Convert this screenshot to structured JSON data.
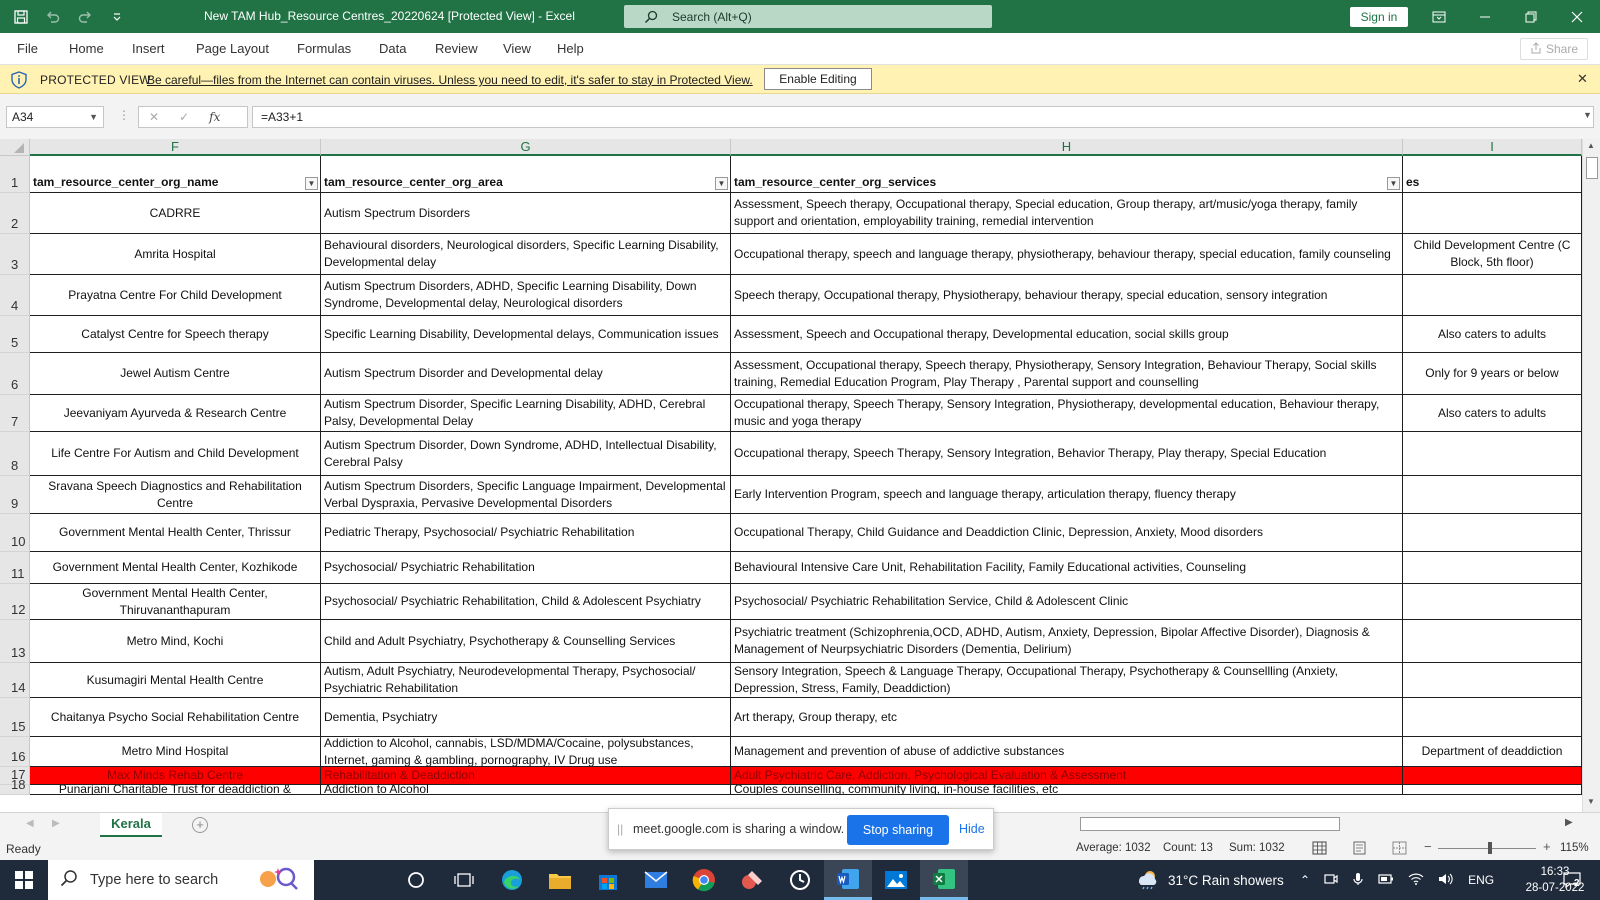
{
  "app": {
    "doc_title": "New TAM Hub_Resource Centres_20220624  [Protected View]  -  Excel",
    "search_placeholder": "Search (Alt+Q)",
    "sign_in": "Sign in",
    "accent": "#217346"
  },
  "menu": {
    "items": [
      "File",
      "Home",
      "Insert",
      "Page Layout",
      "Formulas",
      "Data",
      "Review",
      "View",
      "Help"
    ],
    "share": "Share"
  },
  "protected": {
    "title": "PROTECTED VIEW",
    "message": "Be careful—files from the Internet can contain viruses. Unless you need to edit, it's safer to stay in Protected View.",
    "enable_button": "Enable Editing"
  },
  "formula_bar": {
    "name_box": "A34",
    "formula": "=A33+1"
  },
  "grid": {
    "columns": [
      "F",
      "G",
      "H",
      "I"
    ],
    "header_row": {
      "row": "1",
      "cells": [
        "tam_resource_center_org_name",
        "tam_resource_center_org_area",
        "tam_resource_center_org_services",
        "es"
      ]
    },
    "rows": [
      {
        "row": "2",
        "cells": [
          "CADRRE",
          "Autism Spectrum Disorders",
          " Assessment, Speech therapy, Occupational therapy, Special education, Group therapy, art/music/yoga therapy,  family support and orientation, employability training, remedial intervention",
          ""
        ]
      },
      {
        "row": "3",
        "cells": [
          "Amrita Hospital",
          "Behavioural disorders, Neurological disorders, Specific Learning Disability, Developmental delay",
          " Occupational therapy, speech and language therapy, physiotherapy, behaviour therapy, special education,  family counseling",
          "Child Development Centre (C Block, 5th floor)"
        ]
      },
      {
        "row": "4",
        "cells": [
          "Prayatna Centre For Child Development",
          "Autism Spectrum Disorders, ADHD, Specific Learning Disability, Down Syndrome, Developmental delay, Neurological disorders",
          "Speech therapy, Occupational therapy, Physiotherapy, behaviour therapy, special education, sensory integration",
          ""
        ]
      },
      {
        "row": "5",
        "cells": [
          "Catalyst Centre for Speech therapy",
          "Specific Learning Disability, Developmental delays, Communication issues",
          "Assessment, Speech and Occupational therapy,  Developmental education, social skills group",
          "Also caters to adults"
        ]
      },
      {
        "row": "6",
        "cells": [
          "Jewel Autism Centre",
          "Autism Spectrum Disorder and Developmental delay",
          "Assessment, Occupational therapy, Speech therapy, Physiotherapy, Sensory Integration, Behaviour Therapy,  Social skills training, Remedial Education Program, Play Therapy , Parental support and counselling",
          "Only for 9 years or below"
        ]
      },
      {
        "row": "7",
        "cells": [
          "Jeevaniyam Ayurveda & Research Centre",
          "Autism Spectrum Disorder, Specific Learning Disability, ADHD, Cerebral Palsy, Developmental Delay",
          " Occupational therapy, Speech Therapy, Sensory Integration, Physiotherapy, developmental education,  Behaviour therapy, music and yoga therapy",
          "Also caters to adults"
        ]
      },
      {
        "row": "8",
        "cells": [
          "Life Centre For Autism and Child Development",
          "Autism Spectrum Disorder, Down Syndrome, ADHD, Intellectual Disability, Cerebral Palsy",
          "Occupational therapy, Speech Therapy, Sensory Integration, Behavior Therapy, Play therapy, Special Education",
          ""
        ]
      },
      {
        "row": "9",
        "cells": [
          "Sravana Speech Diagnostics and Rehabilitation Centre",
          "Autism Spectrum Disorders, Specific Language Impairment, Developmental Verbal Dyspraxia,  Pervasive Developmental Disorders",
          "Early Intervention Program, speech and language therapy, articulation therapy, fluency therapy",
          ""
        ]
      },
      {
        "row": "10",
        "cells": [
          "Government Mental Health Center, Thrissur",
          "Pediatric Therapy, Psychosocial/ Psychiatric Rehabilitation",
          "Occupational Therapy, Child Guidance and Deaddiction Clinic, Depression, Anxiety, Mood disorders",
          ""
        ]
      },
      {
        "row": "11",
        "cells": [
          "Government Mental Health Center, Kozhikode",
          "Psychosocial/ Psychiatric Rehabilitation",
          "Behavioural Intensive Care Unit, Rehabilitation Facility, Family Educational activities, Counseling",
          ""
        ]
      },
      {
        "row": "12",
        "cells": [
          "Government Mental Health Center, Thiruvananthapuram",
          "Psychosocial/ Psychiatric Rehabilitation, Child & Adolescent Psychiatry",
          "Psychosocial/ Psychiatric Rehabilitation Service, Child & Adolescent Clinic",
          ""
        ]
      },
      {
        "row": "13",
        "cells": [
          "Metro Mind, Kochi",
          "Child and Adult Psychiatry, Psychotherapy & Counselling Services",
          "Psychiatric treatment (Schizophrenia,OCD, ADHD, Autism, Anxiety, Depression, Bipolar Affective Disorder), Diagnosis & Management of Neurpsychiatric Disorders (Dementia, Delirium)",
          ""
        ]
      },
      {
        "row": "14",
        "cells": [
          "Kusumagiri Mental Health Centre",
          "Autism, Adult Psychiatry, Neurodevelopmental Therapy, Psychosocial/ Psychiatric Rehabilitation",
          "Sensory Integration, Speech & Language Therapy, Occupational Therapy, Psychotherapy & Counsellling (Anxiety, Depression, Stress, Family, Deaddiction)",
          ""
        ]
      },
      {
        "row": "15",
        "cells": [
          "Chaitanya Psycho Social Rehabilitation Centre",
          "Dementia, Psychiatry",
          "Art therapy, Group therapy, etc",
          ""
        ]
      },
      {
        "row": "16",
        "cells": [
          "Metro Mind Hospital",
          "Addiction to Alcohol, cannabis, LSD/MDMA/Cocaine, polysubstances, Internet, gaming & gambling, pornography, IV Drug use",
          "Management and prevention of abuse of addictive substances",
          "Department of deaddiction"
        ]
      },
      {
        "row": "17",
        "cells": [
          "Max Minds Rehab Centre",
          "Rehabilitation & Deaddiction",
          "Adult Psychiatric Care, Addiction, Psychological Evaluation & Assessment",
          ""
        ],
        "highlight": "#ff0000"
      },
      {
        "row": "18",
        "cells": [
          "Punarjani Charitable Trust for deaddiction &",
          "Addiction to Alcohol",
          "Couples counselling, community living, in-house facilities, etc",
          ""
        ]
      }
    ]
  },
  "sheets": {
    "active": "Kerala"
  },
  "sharing": {
    "text": "meet.google.com is sharing a window.",
    "stop": "Stop sharing",
    "hide": "Hide"
  },
  "status": {
    "ready": "Ready",
    "average": "Average: 1032",
    "count": "Count: 13",
    "sum": "Sum: 1032",
    "zoom": "115%"
  },
  "taskbar": {
    "search_placeholder": "Type here to search",
    "weather": "31°C  Rain showers",
    "language": "ENG",
    "time": "16:33",
    "date": "28-07-2022",
    "notifications": "2"
  }
}
